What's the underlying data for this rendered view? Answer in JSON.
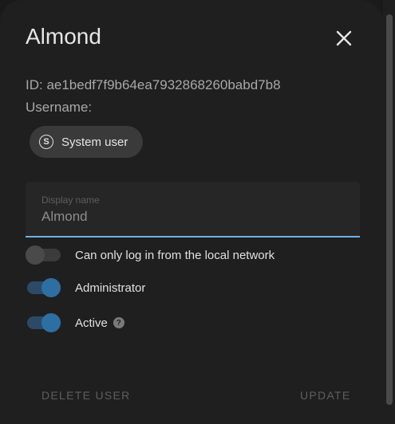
{
  "dialog": {
    "title": "Almond",
    "id_line": "ID: ae1bedf7f9b64ea7932868260babd7b8",
    "username_line": "Username:",
    "chip": {
      "icon_letter": "S",
      "label": "System user",
      "icon": "system-user-icon"
    },
    "display_name": {
      "label": "Display name",
      "value": "Almond"
    },
    "switches": [
      {
        "label": "Can only log in from the local network",
        "on": false
      },
      {
        "label": "Administrator",
        "on": true
      },
      {
        "label": "Active",
        "on": true,
        "help": "?"
      }
    ],
    "actions": {
      "delete_label": "DELETE USER",
      "update_label": "UPDATE"
    }
  },
  "colors": {
    "accent": "#6db1e8",
    "switch_on": "#2e6fa3",
    "surface": "#1f1f1f"
  }
}
